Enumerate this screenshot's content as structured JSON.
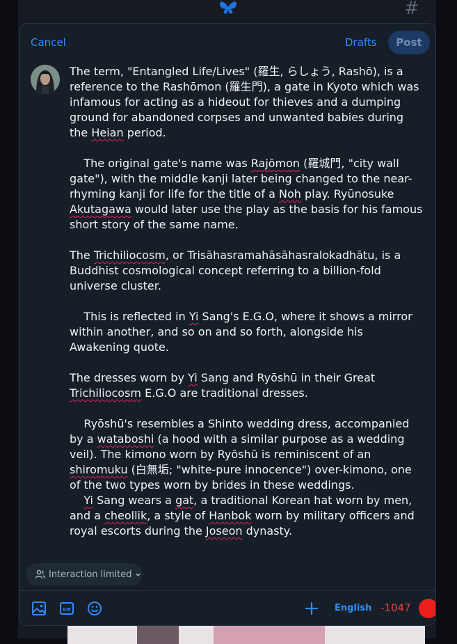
{
  "header": {
    "cancel_label": "Cancel",
    "drafts_label": "Drafts",
    "post_label": "Post"
  },
  "background": {
    "hash_glyph": "#"
  },
  "post": {
    "paragraphs": [
      [
        {
          "t": "The term, \"Entangled Life/Lives\" (羅生, らしょう, Rashō), is a reference to the Rashōmon (羅生門), a gate in Kyoto which was infamous for acting as a hideout for thieves and a dumping ground for abandoned corpses and unwanted babies during the "
        },
        {
          "t": "Heian",
          "s": true
        },
        {
          "t": " period."
        }
      ],
      [
        {
          "t": "    The original gate's name was "
        },
        {
          "t": "Rajōmon",
          "s": true
        },
        {
          "t": " (羅城門, \"city wall gate\"), with the middle kanji later being changed to the near-rhyming kanji for life for the title of a "
        },
        {
          "t": "Noh",
          "s": true
        },
        {
          "t": " play. Ryūnosuke "
        },
        {
          "t": "Akutagawa",
          "s": true
        },
        {
          "t": " would later use the play as the basis for his famous short story of the same name."
        }
      ],
      [
        {
          "t": "The "
        },
        {
          "t": "Trichiliocosm",
          "s": true
        },
        {
          "t": ", or Trisāhasramahāsāhasralokadhātu, is a Buddhist cosmological concept referring to a billion-fold universe cluster."
        }
      ],
      [
        {
          "t": "    This is reflected in "
        },
        {
          "t": "Yi",
          "s": true
        },
        {
          "t": " Sang's E.G.O, where it shows a mirror within another, and so on and so forth, alongside his Awakening quote."
        }
      ],
      [
        {
          "t": "The dresses worn by "
        },
        {
          "t": "Yi",
          "s": true
        },
        {
          "t": " Sang and Ryōshū in their Great "
        },
        {
          "t": "Trichiliocosm",
          "s": true
        },
        {
          "t": " E.G.O are traditional dresses."
        }
      ],
      [
        {
          "t": "    Ryōshū's resembles a Shinto wedding dress, accompanied by a "
        },
        {
          "t": "wataboshi",
          "s": true
        },
        {
          "t": " (a hood with a similar purpose as a wedding veil). The kimono worn by Ryōshū is reminiscent of an "
        },
        {
          "t": "shiromuku",
          "s": true
        },
        {
          "t": " (白無垢; \"white-pure innocence\") over-kimono, one of the two types worn by brides in these weddings.\n    "
        },
        {
          "t": "Yi",
          "s": true
        },
        {
          "t": " Sang wears a "
        },
        {
          "t": "gat",
          "s": true
        },
        {
          "t": ", a traditional Korean hat worn by men, and a "
        },
        {
          "t": "cheollik",
          "s": true
        },
        {
          "t": ", a style of "
        },
        {
          "t": "Hanbok",
          "s": true
        },
        {
          "t": " worn by military officers and royal escorts during the "
        },
        {
          "t": "Joseon",
          "s": true
        },
        {
          "t": " dynasty."
        }
      ]
    ]
  },
  "interaction": {
    "label": "Interaction limited"
  },
  "toolbar": {
    "language": "English",
    "char_count": "-1047"
  },
  "colors": {
    "accent": "#2f8cff",
    "error": "#ec1e1e",
    "post_bg": "#1c3a63"
  },
  "icons": [
    "butterfly-icon",
    "hash-icon",
    "image-icon",
    "gif-icon",
    "emoji-icon",
    "add-icon",
    "people-icon",
    "chevron-down-icon"
  ]
}
